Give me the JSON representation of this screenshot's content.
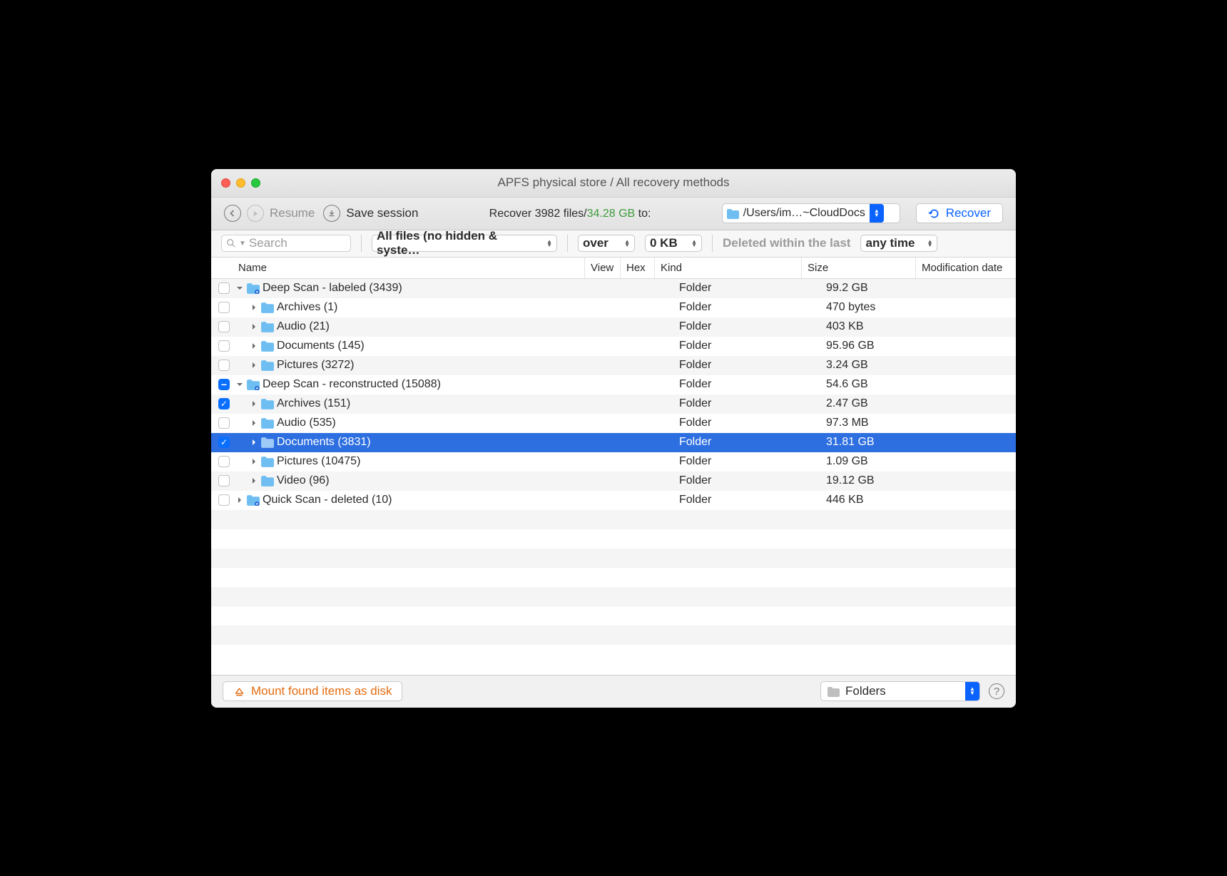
{
  "window": {
    "title": "APFS physical store / All recovery methods"
  },
  "toolbar": {
    "resume_label": "Resume",
    "save_session_label": "Save session",
    "summary_prefix": "Recover ",
    "summary_files": "3982 files/",
    "summary_size": "34.28 GB",
    "summary_suffix": " to:",
    "destination_path": "/Users/im…~CloudDocs",
    "recover_label": "Recover"
  },
  "filters": {
    "search_placeholder": "Search",
    "file_filter": "All files (no hidden & syste…",
    "over_label": "over",
    "size_threshold": "0 KB",
    "deleted_label": "Deleted within the last",
    "time_filter": "any time"
  },
  "columns": {
    "name": "Name",
    "view": "View",
    "hex": "Hex",
    "kind": "Kind",
    "size": "Size",
    "modification": "Modification date"
  },
  "rows": [
    {
      "indent": 0,
      "expanded": true,
      "check": "none",
      "name": "Deep Scan - labeled (3439)",
      "kind": "Folder",
      "size": "99.2 GB",
      "selected": false,
      "special_folder": true
    },
    {
      "indent": 1,
      "expanded": false,
      "check": "none",
      "name": "Archives (1)",
      "kind": "Folder",
      "size": "470 bytes",
      "selected": false
    },
    {
      "indent": 1,
      "expanded": false,
      "check": "none",
      "name": "Audio (21)",
      "kind": "Folder",
      "size": "403 KB",
      "selected": false
    },
    {
      "indent": 1,
      "expanded": false,
      "check": "none",
      "name": "Documents (145)",
      "kind": "Folder",
      "size": "95.96 GB",
      "selected": false
    },
    {
      "indent": 1,
      "expanded": false,
      "check": "none",
      "name": "Pictures (3272)",
      "kind": "Folder",
      "size": "3.24 GB",
      "selected": false
    },
    {
      "indent": 0,
      "expanded": true,
      "check": "mixed",
      "name": "Deep Scan - reconstructed (15088)",
      "kind": "Folder",
      "size": "54.6 GB",
      "selected": false,
      "special_folder": true
    },
    {
      "indent": 1,
      "expanded": false,
      "check": "checked",
      "name": "Archives (151)",
      "kind": "Folder",
      "size": "2.47 GB",
      "selected": false
    },
    {
      "indent": 1,
      "expanded": false,
      "check": "none",
      "name": "Audio (535)",
      "kind": "Folder",
      "size": "97.3 MB",
      "selected": false
    },
    {
      "indent": 1,
      "expanded": false,
      "check": "checked",
      "name": "Documents (3831)",
      "kind": "Folder",
      "size": "31.81 GB",
      "selected": true
    },
    {
      "indent": 1,
      "expanded": false,
      "check": "none",
      "name": "Pictures (10475)",
      "kind": "Folder",
      "size": "1.09 GB",
      "selected": false
    },
    {
      "indent": 1,
      "expanded": false,
      "check": "none",
      "name": "Video (96)",
      "kind": "Folder",
      "size": "19.12 GB",
      "selected": false
    },
    {
      "indent": 0,
      "expanded": false,
      "check": "none",
      "name": "Quick Scan - deleted (10)",
      "kind": "Folder",
      "size": "446 KB",
      "selected": false,
      "special_folder": true
    }
  ],
  "footer": {
    "mount_label": "Mount found items as disk",
    "view_mode": "Folders"
  }
}
